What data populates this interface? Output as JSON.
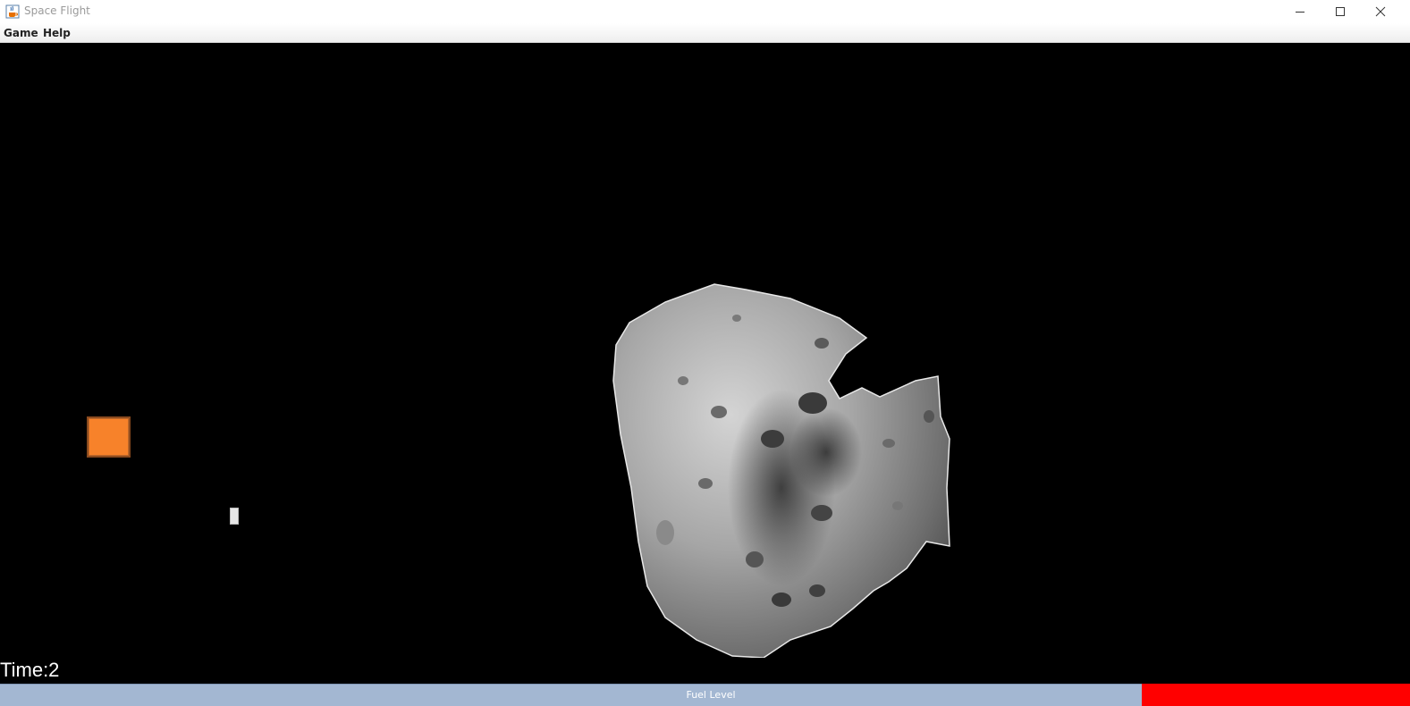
{
  "window": {
    "title": "Space Flight",
    "icon": "java-cup-icon",
    "controls": [
      "minimize-icon",
      "maximize-icon",
      "close-icon"
    ]
  },
  "menu": {
    "items": [
      {
        "label": "Game"
      },
      {
        "label": "Help"
      }
    ]
  },
  "game": {
    "background_color": "#000000",
    "ship_color": "#f7822a",
    "time_label": "Time:2"
  },
  "status": {
    "fuel_label": "Fuel Level",
    "fuel_color": "#ff0000",
    "fuel_track_color": "#a3b7d2",
    "fuel_remaining_fraction": 0.19
  }
}
